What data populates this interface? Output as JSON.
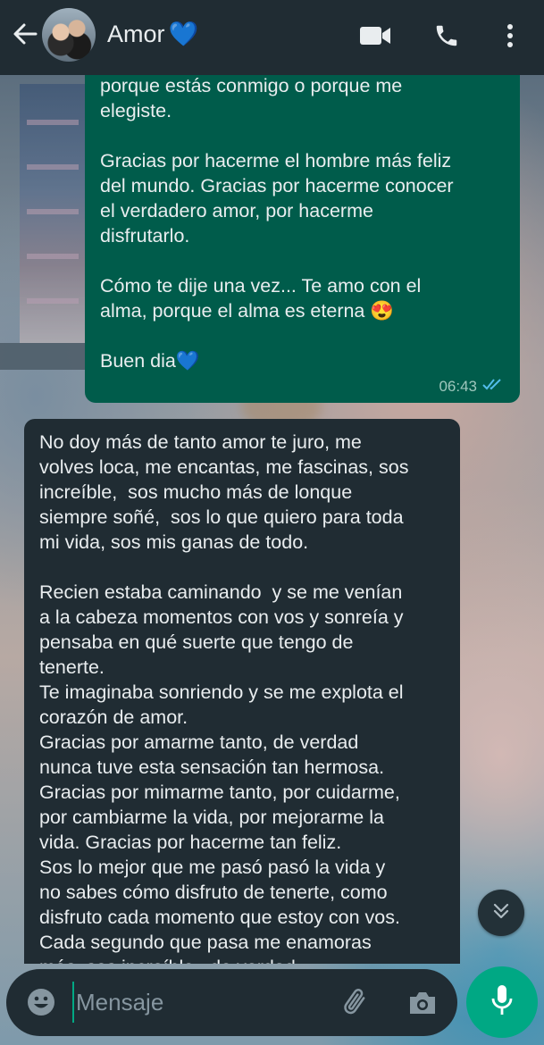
{
  "header": {
    "contact_name": "Amor",
    "contact_emoji": "💙",
    "icons": [
      "back-arrow-icon",
      "video-call-icon",
      "phone-icon",
      "more-vertical-icon"
    ]
  },
  "messages": {
    "outgoing": {
      "text": "porque estás conmigo o porque me\nelegiste.\n\nGracias por hacerme el hombre más feliz\ndel mundo. Gracias por hacerme conocer\nel verdadero amor, por hacerme\ndisfrutarlo.\n\nCómo te dije una vez... Te amo con el\nalma, porque el alma es eterna 😍\n\nBuen dia💙",
      "time": "06:43",
      "status": "read"
    },
    "incoming": {
      "text": "No doy más de tanto amor te juro, me\nvolves loca, me encantas, me fascinas, sos\nincreíble,  sos mucho más de lonque\nsiempre soñé,  sos lo que quiero para toda\nmi vida, sos mis ganas de todo.\n\nRecien estaba caminando  y se me venían\na la cabeza momentos con vos y sonreía y\npensaba en qué suerte que tengo de\ntenerte.\nTe imaginaba sonriendo y se me explota el\ncorazón de amor.\nGracias por amarme tanto, de verdad\nnunca tuve esta sensación tan hermosa.\nGracias por mimarme tanto, por cuidarme,\npor cambiarme la vida, por mejorarme la\nvida. Gracias por hacerme tan feliz.\nSos lo mejor que me pasó pasó la vida y\nno sabes cómo disfruto de tenerte, como\ndisfruto cada momento que estoy con vos.\nCada segundo que pasa me enamoras\nmás, sos increíble , de verdad"
    }
  },
  "composer": {
    "placeholder": "Mensaje",
    "icons": [
      "emoji-icon",
      "attach-icon",
      "camera-icon",
      "mic-icon"
    ]
  },
  "colors": {
    "header_bg": "#202c33",
    "outgoing_bubble": "#005c4b",
    "incoming_bubble": "#202c33",
    "accent": "#00a884",
    "read_ticks": "#53bdeb"
  }
}
